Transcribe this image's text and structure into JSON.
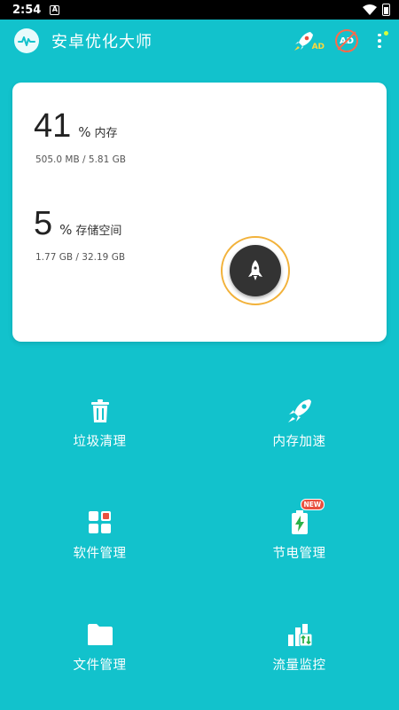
{
  "status_bar": {
    "time": "2:54",
    "notification_glyph": "A"
  },
  "app_bar": {
    "title": "安卓优化大师",
    "ad_label": "AD",
    "no_ad_label": "AD"
  },
  "memory": {
    "value": "41",
    "unit": "%",
    "label": "内存",
    "used": "505.0 MB",
    "separator": "/",
    "total": "5.81 GB"
  },
  "storage": {
    "value": "5",
    "unit": "%",
    "label": "存储空间",
    "used": "1.77 GB",
    "separator": "/",
    "total": "32.19 GB"
  },
  "tools": [
    {
      "label": "垃圾清理",
      "icon": "trash-icon"
    },
    {
      "label": "内存加速",
      "icon": "rocket-icon"
    },
    {
      "label": "软件管理",
      "icon": "apps-grid-icon"
    },
    {
      "label": "节电管理",
      "icon": "battery-bolt-icon",
      "badge": "NEW"
    },
    {
      "label": "文件管理",
      "icon": "folder-icon"
    },
    {
      "label": "流量监控",
      "icon": "traffic-chart-icon"
    }
  ],
  "colors": {
    "background": "#12c2cc",
    "card": "#ffffff",
    "boost_ring": "#f2b23b",
    "badge": "#e9503f"
  }
}
